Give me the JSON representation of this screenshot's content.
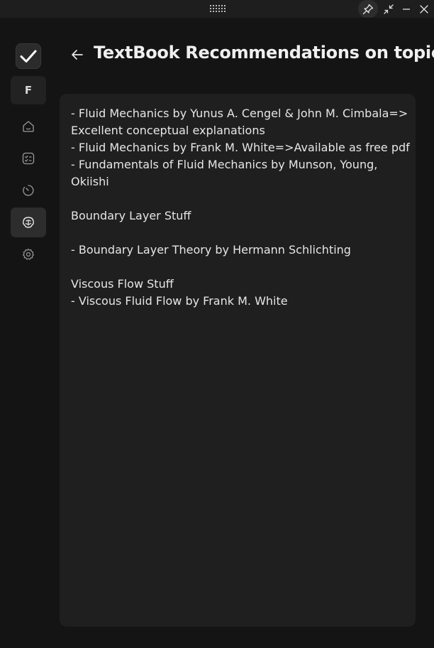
{
  "window": {
    "pin_icon": "pin-icon",
    "collapse_icon": "collapse-icon",
    "minimize_icon": "minimize-icon",
    "close_icon": "close-icon"
  },
  "sidebar": {
    "profile_initial": "F",
    "items": [
      {
        "icon": "home-icon",
        "active": false
      },
      {
        "icon": "checklist-icon",
        "active": false
      },
      {
        "icon": "timer-icon",
        "active": false
      },
      {
        "icon": "ai-brain-icon",
        "active": true
      },
      {
        "icon": "settings-icon",
        "active": false
      }
    ]
  },
  "page": {
    "title": "TextBook Recommendations on topic"
  },
  "note": {
    "lines": [
      "- Fluid Mechanics by Yunus A. Cengel & John M. Cimbala=>",
      "Excellent conceptual explanations",
      "- Fluid Mechanics by Frank M. White=>Available as free pdf",
      "- Fundamentals of Fluid Mechanics by Munson, Young,",
      "Okiishi",
      "",
      "Boundary Layer Stuff",
      "",
      "- Boundary Layer Theory by Hermann Schlichting",
      "",
      "Viscous Flow Stuff",
      "- Viscous Fluid Flow by Frank M. White"
    ]
  },
  "colors": {
    "background": "#141414",
    "card": "#1f1f1f",
    "text": "#e6e6e6",
    "active_nav": "#2d2d2d"
  }
}
